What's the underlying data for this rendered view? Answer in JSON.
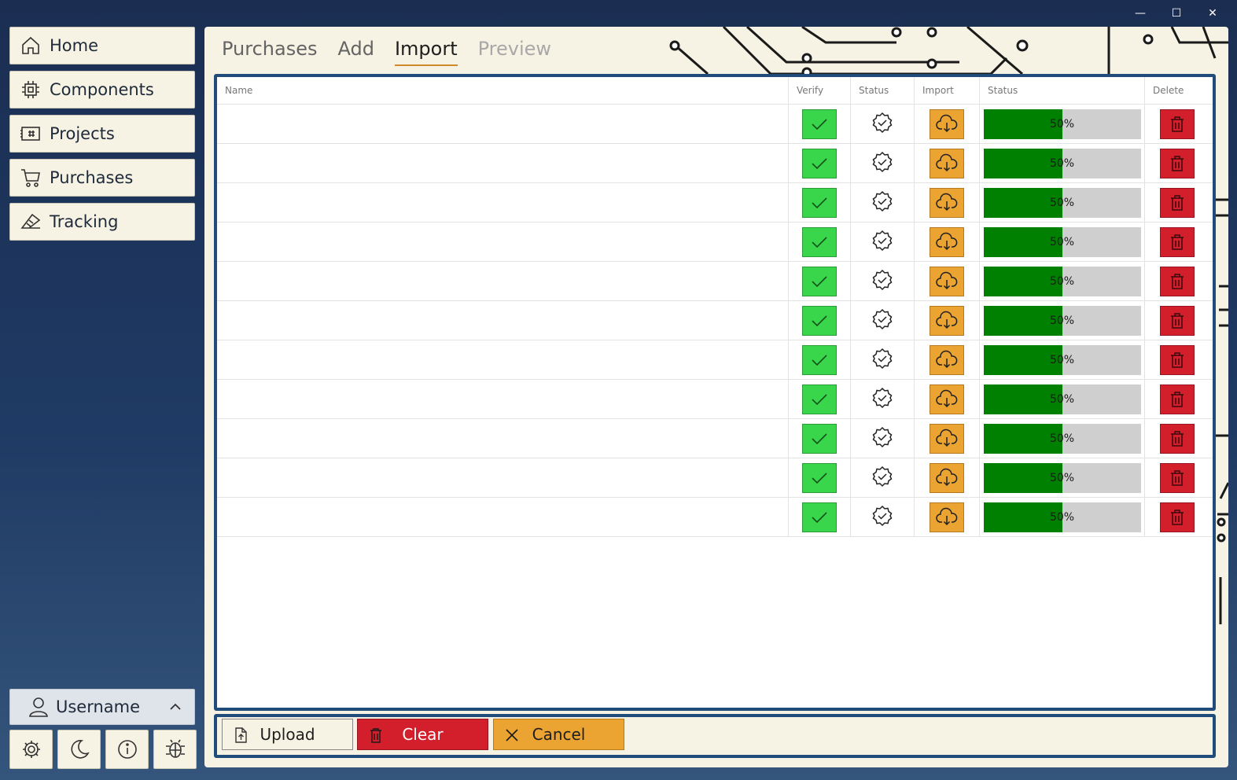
{
  "window": {
    "controls": [
      "minimize-icon",
      "maximize-icon",
      "close-icon"
    ]
  },
  "sidebar": {
    "items": [
      {
        "label": "Home",
        "icon": "home-icon"
      },
      {
        "label": "Components",
        "icon": "chip-icon"
      },
      {
        "label": "Projects",
        "icon": "board-icon"
      },
      {
        "label": "Purchases",
        "icon": "cart-icon"
      },
      {
        "label": "Tracking",
        "icon": "tracking-icon"
      }
    ],
    "user": {
      "label": "Username",
      "icon": "user-icon"
    },
    "bottom_icons": [
      "gear-icon",
      "moon-icon",
      "info-icon",
      "bug-icon"
    ]
  },
  "tabs": [
    {
      "label": "Purchases",
      "state": "normal"
    },
    {
      "label": "Add",
      "state": "normal"
    },
    {
      "label": "Import",
      "state": "active"
    },
    {
      "label": "Preview",
      "state": "disabled"
    }
  ],
  "table": {
    "headers": [
      "Name",
      "Verify",
      "Status",
      "Import",
      "Status",
      "Delete"
    ],
    "rows": [
      {
        "name": "",
        "progress": 50,
        "progress_text": "50%"
      },
      {
        "name": "",
        "progress": 50,
        "progress_text": "50%"
      },
      {
        "name": "",
        "progress": 50,
        "progress_text": "50%"
      },
      {
        "name": "",
        "progress": 50,
        "progress_text": "50%"
      },
      {
        "name": "",
        "progress": 50,
        "progress_text": "50%"
      },
      {
        "name": "",
        "progress": 50,
        "progress_text": "50%"
      },
      {
        "name": "",
        "progress": 50,
        "progress_text": "50%"
      },
      {
        "name": "",
        "progress": 50,
        "progress_text": "50%"
      },
      {
        "name": "",
        "progress": 50,
        "progress_text": "50%"
      },
      {
        "name": "",
        "progress": 50,
        "progress_text": "50%"
      },
      {
        "name": "",
        "progress": 50,
        "progress_text": "50%"
      }
    ]
  },
  "footer": {
    "upload_label": "Upload",
    "clear_label": "Clear",
    "cancel_label": "Cancel"
  },
  "colors": {
    "accent_blue": "#1f4c7a",
    "verify_green": "#39d64b",
    "import_orange": "#eba332",
    "delete_red": "#d21f2b",
    "progress_green": "#008000",
    "panel_cream": "#f6f3e4",
    "tab_underline": "#d08a2c"
  }
}
